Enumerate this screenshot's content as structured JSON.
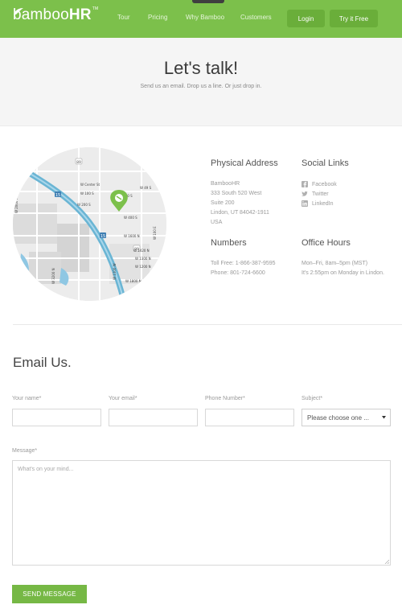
{
  "header": {
    "logo_text_regular": "bamboo",
    "logo_text_bold": "HR",
    "logo_tm": "TM",
    "nav": [
      "Tour",
      "Pricing",
      "Why Bamboo",
      "Customers"
    ],
    "login_label": "Login",
    "try_label": "Try it Free"
  },
  "hero": {
    "title": "Let's talk!",
    "subtitle": "Send us an email. Drop us a line. Or just drop in."
  },
  "map": {
    "streets": [
      "W Center St",
      "W 100 S",
      "W 200 S",
      "W 300 S",
      "W 400 S",
      "W 49 S",
      "W 1600 N",
      "W 1420 N",
      "W 1300 N",
      "W 1200 N",
      "W 1800 N",
      "W 1000 N",
      "W 2000 W",
      "W 1300 W",
      "W 3200 N",
      "W 100 E"
    ],
    "highway": "15",
    "roads": [
      "89",
      "89"
    ]
  },
  "contact": {
    "address_heading": "Physical Address",
    "address_lines": [
      "BambooHR",
      "333 South 520 West",
      "Suite 200",
      "Lindon, UT 84042-1911",
      "USA"
    ],
    "social_heading": "Social Links",
    "social_links": [
      "Facebook",
      "Twitter",
      "LinkedIn"
    ],
    "numbers_heading": "Numbers",
    "numbers_lines": [
      "Toll Free: 1-866-387-9595",
      "Phone: 801-724-6600"
    ],
    "hours_heading": "Office Hours",
    "hours_lines": [
      "Mon–Fri, 8am–5pm (MST)",
      "It's 2:55pm on Monday in Lindon."
    ]
  },
  "form": {
    "title": "Email Us.",
    "name_label": "Your name*",
    "email_label": "Your email*",
    "phone_label": "Phone Number*",
    "subject_label": "Subject*",
    "subject_selected": "Please choose one ...",
    "message_label": "Message*",
    "message_placeholder": "What's on your mind...",
    "send_label": "SEND MESSAGE"
  },
  "colors": {
    "brand_green": "#7cc04b",
    "button_green": "#76b845",
    "map_route": "#6ab5d4",
    "map_pin": "#7cc04b"
  }
}
